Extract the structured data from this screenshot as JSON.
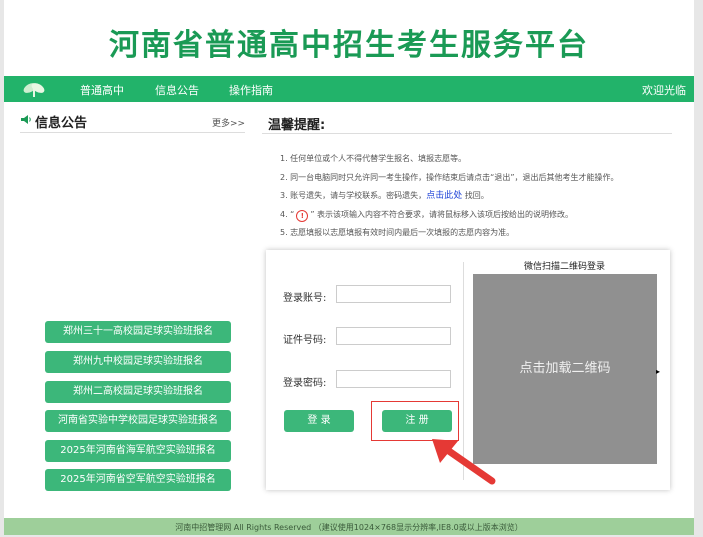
{
  "header": {
    "title": "河南省普通高中招生考生服务平台"
  },
  "nav": {
    "items": [
      "普通高中",
      "信息公告",
      "操作指南"
    ],
    "welcome": "欢迎光临"
  },
  "info": {
    "title": "信息公告",
    "more": "更多>>",
    "buttons": [
      "郑州三十一高校园足球实验班报名",
      "郑州九中校园足球实验班报名",
      "郑州二高校园足球实验班报名",
      "河南省实验中学校园足球实验班报名",
      "2025年河南省海军航空实验班报名",
      "2025年河南省空军航空实验班报名"
    ]
  },
  "notice": {
    "title": "温馨提醒:",
    "item1": "1. 任何单位或个人不得代替学生报名、填报志愿等。",
    "item2": "2. 同一台电脑同时只允许同一考生操作，操作结束后请点击“退出”，退出后其他考生才能操作。",
    "item3_pre": "3. 账号遗失，请与学校联系。密码遗失，",
    "item3_link": "点击此处",
    "item3_post": " 找回。",
    "item4_pre": "4. “",
    "item4_badge": "!",
    "item4_post": "” 表示该项输入内容不符合要求，请将鼠标移入该项后按给出的说明修改。",
    "item5": "5. 志愿填报以志愿填报有效时间内最后一次填报的志愿内容为准。"
  },
  "login": {
    "account_label": "登录账号:",
    "id_label": "证件号码:",
    "password_label": "登录密码:",
    "login_button": "登 录",
    "register_button": "注 册"
  },
  "qr": {
    "title": "微信扫描二维码登录",
    "load_text": "点击加载二维码"
  },
  "footer": {
    "text": "河南中招管理网 All Rights Reserved  （建议使用1024×768显示分辨率,IE8.0或以上版本浏览）"
  },
  "colors": {
    "brand": "#22b36a",
    "button": "#3cb77a",
    "highlight": "#e53935"
  }
}
